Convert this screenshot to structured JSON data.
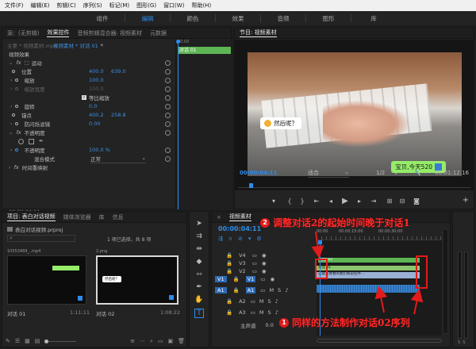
{
  "menu": [
    "文件(F)",
    "编辑(E)",
    "剪辑(C)",
    "序列(S)",
    "标记(M)",
    "图形(G)",
    "窗口(W)",
    "帮助(H)"
  ],
  "workspaces": [
    "组件",
    "编辑",
    "颜色",
    "效果",
    "音频",
    "图形",
    "库"
  ],
  "active_workspace": "编辑",
  "left_panel": {
    "tabs": [
      "源：(无剪辑)",
      "效果控件",
      "音频剪辑混合器: 视频素材",
      "元数据"
    ],
    "active_tab": "效果控件",
    "master_label": "主要 * 视频素材.mp4",
    "sequence_label": "视频素材 * 对话 01",
    "clip_name": "对话 01",
    "header_timecode": "00:00",
    "video_effects_label": "视频效果",
    "motion": "运动",
    "position_label": "位置",
    "position_x": "400.0",
    "position_y": "639.0",
    "scale_label": "缩放",
    "scale_value": "100.0",
    "scale_width_label": "缩放宽度",
    "scale_width_value": "100.0",
    "uniform_scale_label": "等比缩放",
    "rotation_label": "旋转",
    "rotation_value": "0.0",
    "anchor_label": "锚点",
    "anchor_x": "400.2",
    "anchor_y": "258.8",
    "flicker_label": "防闪烁滤镜",
    "flicker_value": "0.00",
    "opacity": "不透明度",
    "opacity_label": "不透明度",
    "opacity_value": "100.0 %",
    "blend_label": "混合模式",
    "blend_value": "正常",
    "time_remap": "时间重映射",
    "bottom_timecode": "00:00:04:11"
  },
  "program": {
    "tab": "节目: 视频素材",
    "timecode": "00:00:04:11",
    "fit": "适合",
    "ratio": "1/2",
    "duration": "00:01:12:16",
    "bubble_left": "然后呢？",
    "bubble_right": "宝贝,今天520"
  },
  "project": {
    "tabs": [
      "项目: 表白对话视频",
      "媒体浏览器",
      "库",
      "信息"
    ],
    "active_tab": "项目: 表白对话视频",
    "file_name": "表白对话视频.prproj",
    "selection_info": "1 项已选择，共 8 项",
    "thumbs": [
      {
        "top_label": "10553469_..mp4",
        "name": "对话 01",
        "duration": "1:11:11"
      },
      {
        "top_label": "2.png",
        "name": "对话 02",
        "duration": "1:08:22"
      }
    ],
    "thumb_bubble": "然后呢？"
  },
  "timeline": {
    "tab": "视频素材",
    "timecode": "00:00:04:11",
    "ruler": [
      "00:00",
      "00:00:15:00",
      "00:00:30:00"
    ],
    "tracks": [
      "V4",
      "V3",
      "V2",
      "V1",
      "A1",
      "A2",
      "A3"
    ],
    "master": "主声道",
    "master_value": "0.0",
    "clip_v3": "对话 02",
    "clip_v2": "对话 01",
    "clip_v1": "这就是青春的我们和前任怀..."
  },
  "annotations": {
    "callout1_num": "1",
    "callout1": "同样的方法制作对话02序列",
    "callout2_num": "2",
    "callout2": "调整对话2的起始时间晚于对话1"
  },
  "colors": {
    "accent": "#2d8ceb",
    "value": "#3e8fe0",
    "clip_green": "#5db554",
    "red": "#e21b1b"
  }
}
